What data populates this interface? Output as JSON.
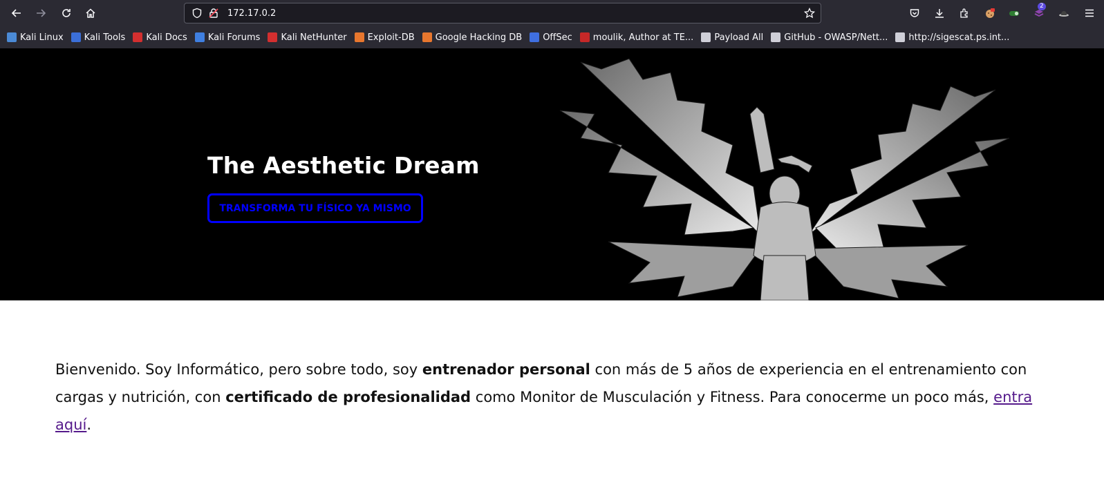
{
  "browser": {
    "url": "172.17.0.2",
    "extension_badge": "2",
    "bookmarks": [
      {
        "label": "Kali Linux",
        "color": "#4b8ad6"
      },
      {
        "label": "Kali Tools",
        "color": "#3b6fd8"
      },
      {
        "label": "Kali Docs",
        "color": "#d32f2f"
      },
      {
        "label": "Kali Forums",
        "color": "#3f7fe0"
      },
      {
        "label": "Kali NetHunter",
        "color": "#d32f2f"
      },
      {
        "label": "Exploit-DB",
        "color": "#e8772e"
      },
      {
        "label": "Google Hacking DB",
        "color": "#e8772e"
      },
      {
        "label": "OffSec",
        "color": "#3f6fe0"
      },
      {
        "label": "moulik, Author at TE...",
        "color": "#c62828"
      },
      {
        "label": "Payload All",
        "color": "#cfcfd8"
      },
      {
        "label": "GitHub - OWASP/Nett...",
        "color": "#cfcfd8"
      },
      {
        "label": "http://sigescat.ps.int...",
        "color": "#cfcfd8"
      }
    ]
  },
  "hero": {
    "title": "The Aesthetic Dream",
    "cta_label": "TRANSFORMA TU FÍSICO YA MISMO",
    "accent_color": "#0000ff"
  },
  "intro": {
    "part1": "Bienvenido. Soy Informático, pero sobre todo, soy ",
    "bold1": "entrenador personal",
    "part2": " con más de 5 años de experiencia en el entrenamiento con cargas y nutrición, con ",
    "bold2": "certificado de profesionalidad",
    "part3": " como Monitor de Musculación y Fitness. Para conocerme un poco más, ",
    "link": "entra aquí",
    "part4": "."
  }
}
